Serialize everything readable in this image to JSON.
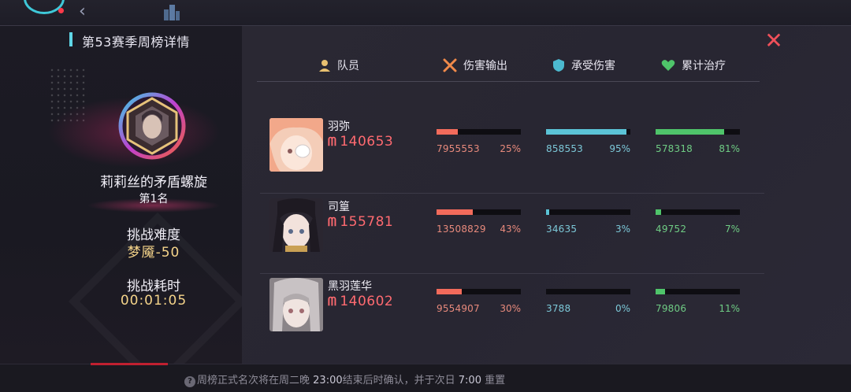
{
  "panel": {
    "title": "第53赛季周榜详情"
  },
  "boss": {
    "name": "莉莉丝的矛盾螺旋",
    "rank": "第1名",
    "difficulty_label": "挑战难度",
    "difficulty_value": "梦魇-50",
    "time_label": "挑战耗时",
    "time_value": "00:01:05"
  },
  "table": {
    "headers": {
      "member": "队员",
      "damage": "伤害输出",
      "taken": "承受伤害",
      "heal": "累计治疗"
    },
    "rows": [
      {
        "name": "羽弥",
        "power": "140653",
        "damage": {
          "value": "7955553",
          "pct": "25%",
          "ratio": 0.25
        },
        "taken": {
          "value": "858553",
          "pct": "95%",
          "ratio": 0.95
        },
        "heal": {
          "value": "578318",
          "pct": "81%",
          "ratio": 0.81
        }
      },
      {
        "name": "司篁",
        "power": "155781",
        "damage": {
          "value": "13508829",
          "pct": "43%",
          "ratio": 0.43
        },
        "taken": {
          "value": "34635",
          "pct": "3%",
          "ratio": 0.03
        },
        "heal": {
          "value": "49752",
          "pct": "7%",
          "ratio": 0.07
        }
      },
      {
        "name": "黑羽莲华",
        "power": "140602",
        "damage": {
          "value": "9554907",
          "pct": "30%",
          "ratio": 0.3
        },
        "taken": {
          "value": "3788",
          "pct": "0%",
          "ratio": 0.0
        },
        "heal": {
          "value": "79806",
          "pct": "11%",
          "ratio": 0.11
        }
      }
    ]
  },
  "footer": {
    "text_a": "周榜正式名次将在周二晚",
    "time_a": "23:00",
    "text_b": "结束后时确认，并于次日",
    "time_b": "7:00",
    "text_c": "重置"
  },
  "colors": {
    "damage": "#f26b5b",
    "taken": "#5bc3d6",
    "heal": "#4fc46a",
    "power": "#ff6a70",
    "accent": "#5fd6e6"
  },
  "icons": {
    "member": "person-icon",
    "damage": "crossed-swords-icon",
    "taken": "shield-icon",
    "heal": "heart-icon",
    "close": "close-icon",
    "power": "power-icon"
  }
}
